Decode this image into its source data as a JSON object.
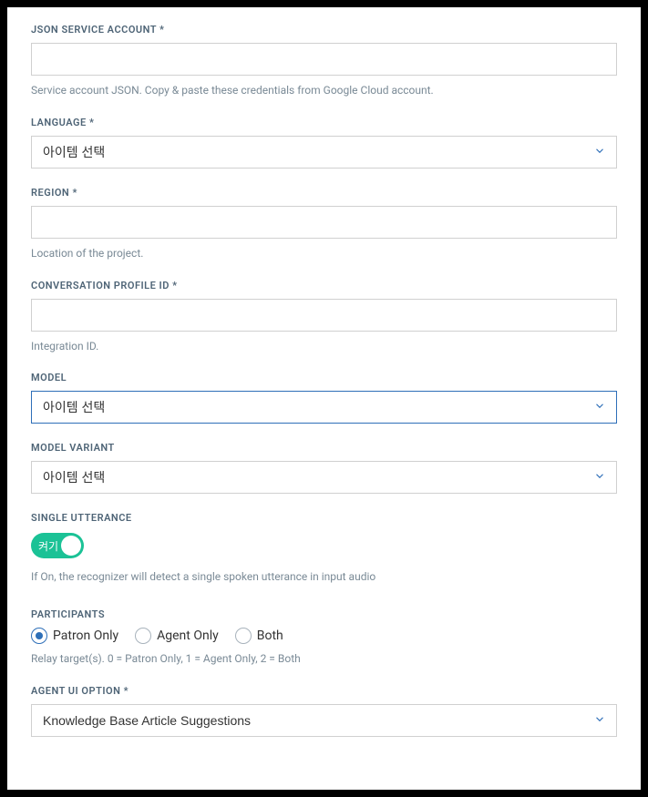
{
  "jsonServiceAccount": {
    "label": "JSON SERVICE ACCOUNT *",
    "value": "",
    "help": "Service account JSON. Copy & paste these credentials from Google Cloud account."
  },
  "language": {
    "label": "LANGUAGE *",
    "value": "아이템 선택"
  },
  "region": {
    "label": "REGION *",
    "value": "",
    "help": "Location of the project."
  },
  "conversationProfileId": {
    "label": "CONVERSATION PROFILE ID *",
    "value": "",
    "help": "Integration ID."
  },
  "model": {
    "label": "MODEL",
    "value": "아이템 선택"
  },
  "modelVariant": {
    "label": "MODEL VARIANT",
    "value": "아이템 선택"
  },
  "singleUtterance": {
    "label": "SINGLE UTTERANCE",
    "toggleLabel": "켜기",
    "help": "If On, the recognizer will detect a single spoken utterance in input audio"
  },
  "participants": {
    "label": "PARTICIPANTS",
    "options": [
      {
        "label": "Patron Only",
        "checked": true
      },
      {
        "label": "Agent Only",
        "checked": false
      },
      {
        "label": "Both",
        "checked": false
      }
    ],
    "help": "Relay target(s). 0 = Patron Only, 1 = Agent Only, 2 = Both"
  },
  "agentUiOption": {
    "label": "AGENT UI OPTION *",
    "value": "Knowledge Base Article Suggestions"
  }
}
